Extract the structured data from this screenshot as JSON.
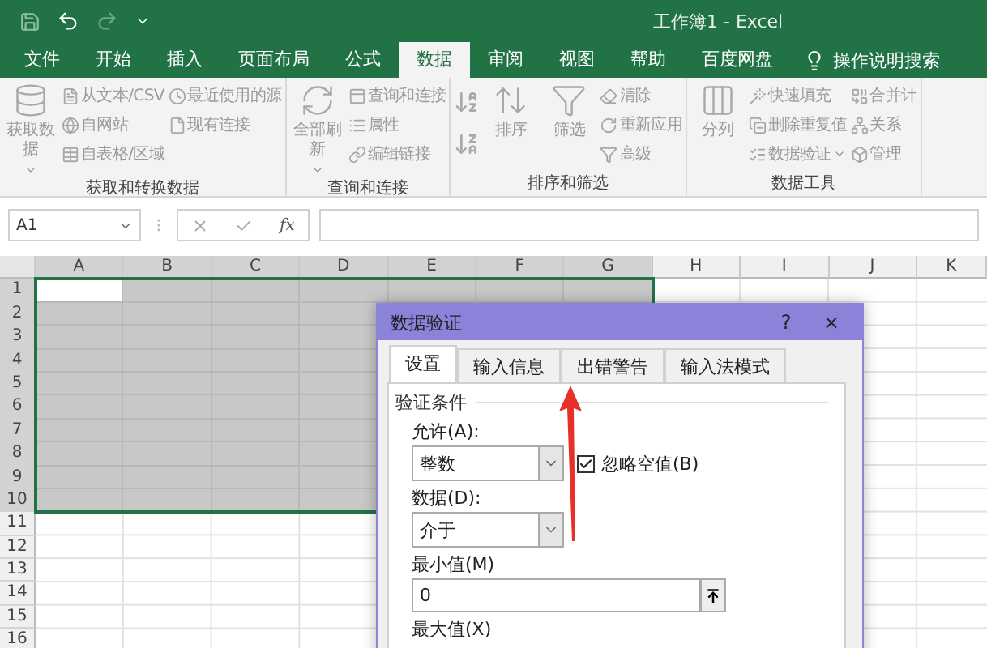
{
  "title_bar": {
    "title": "工作簿1  -  Excel"
  },
  "ribbon_tabs": [
    {
      "label": "文件",
      "selected": false
    },
    {
      "label": "开始",
      "selected": false
    },
    {
      "label": "插入",
      "selected": false
    },
    {
      "label": "页面布局",
      "selected": false
    },
    {
      "label": "公式",
      "selected": false
    },
    {
      "label": "数据",
      "selected": true
    },
    {
      "label": "审阅",
      "selected": false
    },
    {
      "label": "视图",
      "selected": false
    },
    {
      "label": "帮助",
      "selected": false
    },
    {
      "label": "百度网盘",
      "selected": false
    }
  ],
  "search": {
    "placeholder": "操作说明搜索"
  },
  "ribbon_groups": [
    {
      "label": "获取和转换数据",
      "columns": [
        [
          {
            "kind": "large",
            "label": "获取数据",
            "dropdown": true
          }
        ],
        [
          {
            "kind": "small",
            "label": "从文本/CSV",
            "dropdown": false
          },
          {
            "kind": "small",
            "label": "自网站",
            "dropdown": false
          },
          {
            "kind": "small",
            "label": "自表格/区域",
            "dropdown": false
          }
        ],
        [
          {
            "kind": "small",
            "label": "最近使用的源",
            "dropdown": false
          },
          {
            "kind": "small",
            "label": "现有连接",
            "dropdown": false
          }
        ]
      ]
    },
    {
      "label": "查询和连接",
      "columns": [
        [
          {
            "kind": "large",
            "label": "全部刷新",
            "dropdown": true
          }
        ],
        [
          {
            "kind": "small",
            "label": "查询和连接",
            "dropdown": false
          },
          {
            "kind": "small",
            "label": "属性",
            "dropdown": false
          },
          {
            "kind": "small",
            "label": "编辑链接",
            "dropdown": false
          }
        ]
      ]
    },
    {
      "label": "排序和筛选",
      "columns": [
        [
          {
            "kind": "icon",
            "dropdown": false
          },
          {
            "kind": "icon",
            "dropdown": false
          }
        ],
        [
          {
            "kind": "large",
            "label": "排序",
            "dropdown": false
          }
        ],
        [
          {
            "kind": "large",
            "label": "筛选",
            "dropdown": false
          }
        ],
        [
          {
            "kind": "small",
            "label": "清除",
            "dropdown": false
          },
          {
            "kind": "small",
            "label": "重新应用",
            "dropdown": false
          },
          {
            "kind": "small",
            "label": "高级",
            "dropdown": false
          }
        ]
      ]
    },
    {
      "label": "数据工具",
      "columns": [
        [
          {
            "kind": "large",
            "label": "分列",
            "dropdown": false
          }
        ],
        [
          {
            "kind": "small",
            "label": "快速填充",
            "dropdown": false
          },
          {
            "kind": "small",
            "label": "删除重复值",
            "dropdown": false
          },
          {
            "kind": "small",
            "label": "数据验证",
            "dropdown": true
          }
        ],
        [
          {
            "kind": "small",
            "label": "合并计",
            "dropdown": false
          },
          {
            "kind": "small",
            "label": "关系",
            "dropdown": false
          },
          {
            "kind": "small",
            "label": "管理",
            "dropdown": false
          }
        ]
      ]
    }
  ],
  "formula_bar": {
    "name_box": "A1",
    "function_label": "fx"
  },
  "sheet": {
    "columns": [
      {
        "label": "A",
        "selected": true
      },
      {
        "label": "B",
        "selected": true
      },
      {
        "label": "C",
        "selected": true
      },
      {
        "label": "D",
        "selected": true
      },
      {
        "label": "E",
        "selected": true
      },
      {
        "label": "F",
        "selected": true
      },
      {
        "label": "G",
        "selected": true
      },
      {
        "label": "H",
        "selected": false
      },
      {
        "label": "I",
        "selected": false
      },
      {
        "label": "J",
        "selected": false
      },
      {
        "label": "K",
        "selected": false
      }
    ],
    "rows": [
      {
        "label": "1",
        "selected": true
      },
      {
        "label": "2",
        "selected": true
      },
      {
        "label": "3",
        "selected": true
      },
      {
        "label": "4",
        "selected": true
      },
      {
        "label": "5",
        "selected": true
      },
      {
        "label": "6",
        "selected": true
      },
      {
        "label": "7",
        "selected": true
      },
      {
        "label": "8",
        "selected": true
      },
      {
        "label": "9",
        "selected": true
      },
      {
        "label": "10",
        "selected": true
      },
      {
        "label": "11",
        "selected": false
      },
      {
        "label": "12",
        "selected": false
      },
      {
        "label": "13",
        "selected": false
      },
      {
        "label": "14",
        "selected": false
      },
      {
        "label": "15",
        "selected": false
      },
      {
        "label": "16",
        "selected": false
      }
    ]
  },
  "dialog": {
    "title": "数据验证",
    "help": "?",
    "close": "×",
    "tabs": [
      {
        "label": "设置",
        "selected": true
      },
      {
        "label": "输入信息",
        "selected": false
      },
      {
        "label": "出错警告",
        "selected": false
      },
      {
        "label": "输入法模式",
        "selected": false
      }
    ],
    "section": "验证条件",
    "allow": {
      "label": "允许(A):",
      "value": "整数"
    },
    "ignore_blank": {
      "label": "忽略空值(B)",
      "checked": true
    },
    "data": {
      "label": "数据(D):",
      "value": "介于"
    },
    "minimum": {
      "label": "最小值(M)",
      "value": "0"
    },
    "maximum": {
      "label": "最大值(X)"
    }
  }
}
